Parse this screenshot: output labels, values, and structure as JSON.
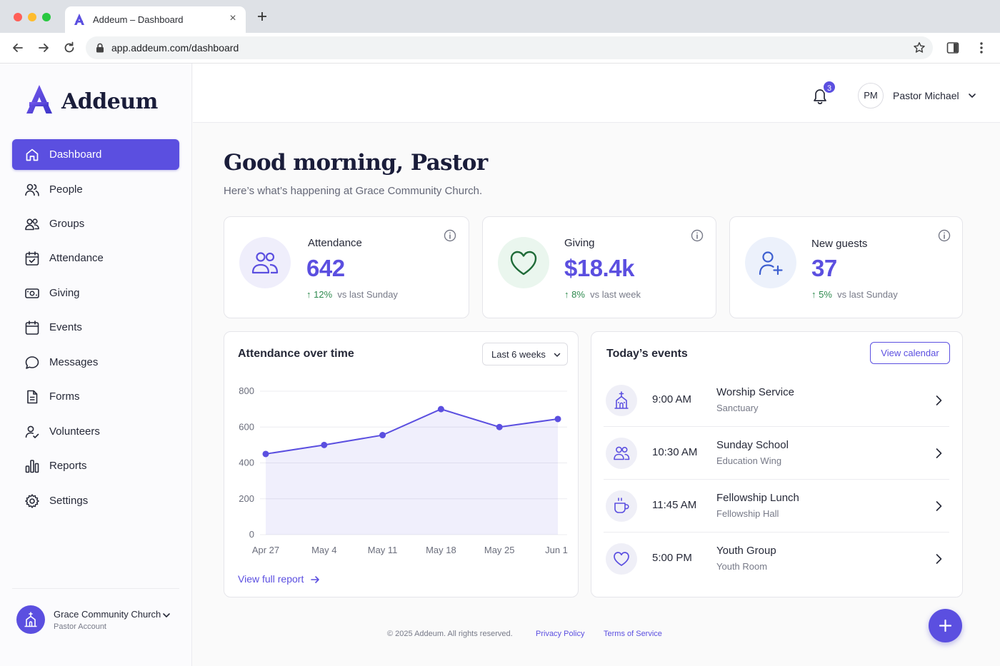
{
  "browser": {
    "tab_title": "Addeum – Dashboard",
    "url": "app.addeum.com/dashboard"
  },
  "brand": {
    "name": "Addeum",
    "accent": "#5b4fe0"
  },
  "sidebar": {
    "items": [
      {
        "label": "Dashboard",
        "icon": "home-icon",
        "active": true
      },
      {
        "label": "People",
        "icon": "people-icon"
      },
      {
        "label": "Groups",
        "icon": "groups-icon"
      },
      {
        "label": "Attendance",
        "icon": "calendar-check-icon"
      },
      {
        "label": "Giving",
        "icon": "dollar-icon"
      },
      {
        "label": "Events",
        "icon": "calendar-icon"
      },
      {
        "label": "Messages",
        "icon": "chat-icon"
      },
      {
        "label": "Forms",
        "icon": "document-icon"
      },
      {
        "label": "Volunteers",
        "icon": "volunteer-icon"
      },
      {
        "label": "Reports",
        "icon": "bar-chart-icon"
      },
      {
        "label": "Settings",
        "icon": "gear-icon"
      }
    ],
    "org": {
      "name": "Grace Community Church",
      "role": "Pastor Account"
    }
  },
  "header": {
    "notifications": "3",
    "user_initials": "PM",
    "user_name": "Pastor Michael"
  },
  "main": {
    "greeting": "Good morning, Pastor",
    "subtitle": "Here’s what’s happening at Grace Community Church."
  },
  "stats": [
    {
      "label": "Attendance",
      "value": "642",
      "delta": "12%",
      "vs": "vs last Sunday",
      "icon": "people-icon"
    },
    {
      "label": "Giving",
      "value": "$18.4k",
      "delta": "8%",
      "vs": "vs last week",
      "icon": "heart-icon"
    },
    {
      "label": "New guests",
      "value": "37",
      "delta": "5%",
      "vs": "vs last Sunday",
      "icon": "user-plus-icon"
    }
  ],
  "attendance_panel": {
    "title": "Attendance over time",
    "range": "Last 6 weeks",
    "link": "View full report"
  },
  "chart_data": {
    "type": "area",
    "categories": [
      "Apr 27",
      "May 4",
      "May 11",
      "May 18",
      "May 25",
      "Jun 1"
    ],
    "values": [
      450,
      500,
      555,
      700,
      600,
      645
    ],
    "yticks": [
      "0",
      "200",
      "400",
      "600",
      "800"
    ],
    "ylim": [
      0,
      800
    ],
    "grid": true,
    "color": "#5b4fe0"
  },
  "events_panel": {
    "title": "Today’s events",
    "button": "View calendar",
    "events": [
      {
        "time": "9:00 AM",
        "name": "Worship Service",
        "place": "Sanctuary",
        "icon": "church-icon"
      },
      {
        "time": "10:30 AM",
        "name": "Sunday School",
        "place": "Education Wing",
        "icon": "people-icon"
      },
      {
        "time": "11:45 AM",
        "name": "Fellowship Lunch",
        "place": "Fellowship Hall",
        "icon": "coffee-icon"
      },
      {
        "time": "5:00 PM",
        "name": "Youth Group",
        "place": "Youth Room",
        "icon": "heart-icon"
      }
    ]
  },
  "footer": {
    "copyright": "© 2025 Addeum. All rights reserved.",
    "privacy": "Privacy Policy",
    "terms": "Terms of Service"
  }
}
